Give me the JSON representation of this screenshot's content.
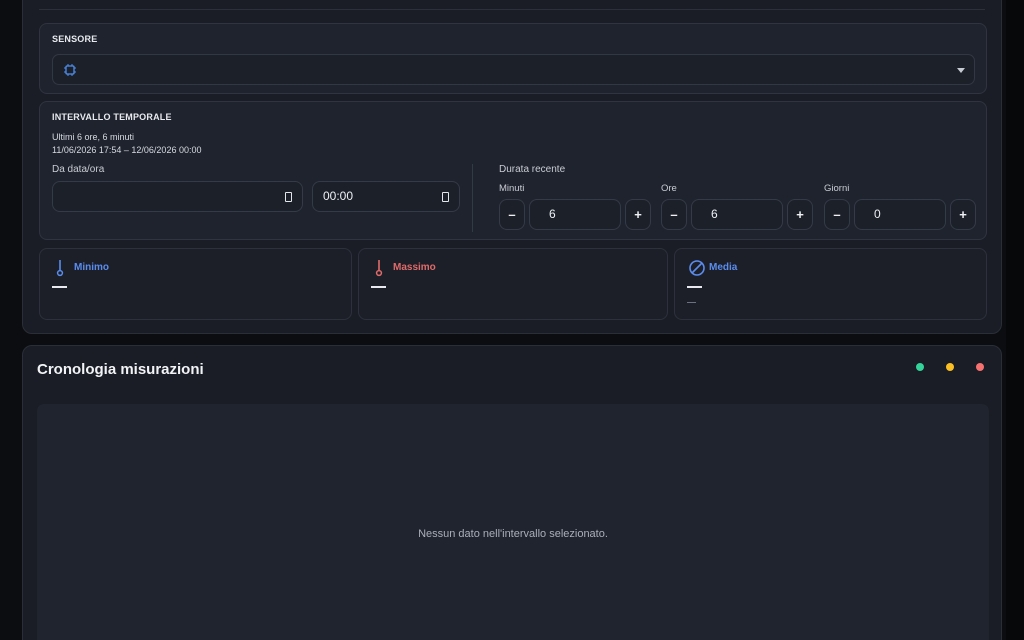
{
  "sensor": {
    "label": "SENSORE",
    "selected_icon": "chip-icon"
  },
  "interval": {
    "label": "INTERVALLO TEMPORALE",
    "summary": "Ultimi 6 ore, 6 minuti",
    "range": "11/06/2026 17:54 – 12/06/2026 00:00",
    "from_label": "Da data/ora",
    "date_value": "",
    "time_value": "00:00",
    "recent_label": "Durata recente",
    "minutes": {
      "label": "Minuti",
      "value": "6",
      "minus": "–",
      "plus": "+"
    },
    "hours": {
      "label": "Ore",
      "value": "6",
      "minus": "–",
      "plus": "+"
    },
    "days": {
      "label": "Giorni",
      "value": "0",
      "minus": "–",
      "plus": "+"
    }
  },
  "stats": {
    "min": {
      "title": "Minimo",
      "color": "#5b8def",
      "icon": "thermometer-low-icon"
    },
    "max": {
      "title": "Massimo",
      "color": "#e06b6b",
      "icon": "thermometer-high-icon"
    },
    "avg": {
      "title": "Media",
      "color": "#5b8def",
      "icon": "average-icon"
    }
  },
  "history": {
    "title": "Cronologia misurazioni",
    "dots": [
      "#34d399",
      "#fbbf24",
      "#f87171"
    ],
    "empty_message": "Nessun dato nell'intervallo selezionato."
  }
}
